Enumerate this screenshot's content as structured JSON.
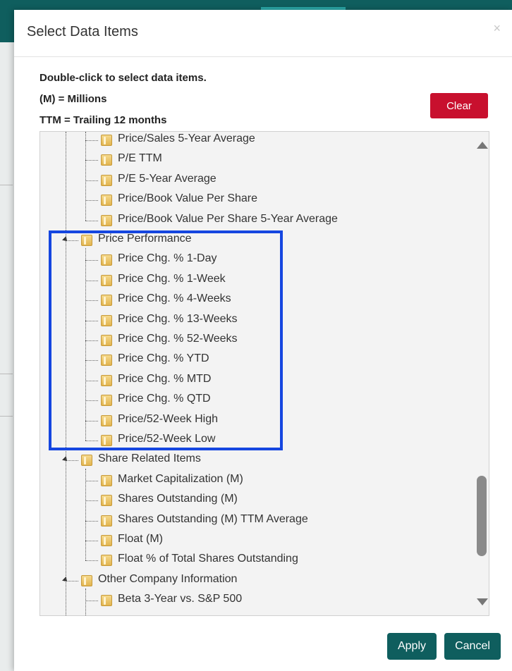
{
  "dialog": {
    "title": "Select Data Items",
    "close_icon": "×",
    "instructions": [
      "Double-click to select data items.",
      "(M) = Millions",
      "TTM = Trailing 12 months"
    ],
    "clear_label": "Clear",
    "apply_label": "Apply",
    "cancel_label": "Cancel"
  },
  "colors": {
    "clear_button": "#c8102e",
    "primary_button": "#0f5e5e",
    "highlight_box": "#1546e0"
  },
  "tree": {
    "valuation_items": [
      "Price/Sales 5-Year Average",
      "P/E TTM",
      "P/E 5-Year Average",
      "Price/Book Value Per Share",
      "Price/Book Value Per Share 5-Year Average"
    ],
    "groups": [
      {
        "name": "Price Performance",
        "items": [
          "Price Chg. % 1-Day",
          "Price Chg. % 1-Week",
          "Price Chg. % 4-Weeks",
          "Price Chg. % 13-Weeks",
          "Price Chg. % 52-Weeks",
          "Price Chg. % YTD",
          "Price Chg. % MTD",
          "Price Chg. % QTD",
          "Price/52-Week High",
          "Price/52-Week Low"
        ]
      },
      {
        "name": "Share Related Items",
        "items": [
          "Market Capitalization (M)",
          "Shares Outstanding (M)",
          "Shares Outstanding (M) TTM Average",
          "Float (M)",
          "Float % of Total Shares Outstanding"
        ]
      },
      {
        "name": "Other Company Information",
        "items": [
          "Beta 3-Year vs. S&P 500"
        ]
      }
    ]
  },
  "icons": {
    "folder": "folder-icon",
    "expand": "expand-triangle-icon",
    "scroll_up": "scroll-up-arrow-icon",
    "scroll_down": "scroll-down-arrow-icon",
    "close": "close-icon"
  }
}
